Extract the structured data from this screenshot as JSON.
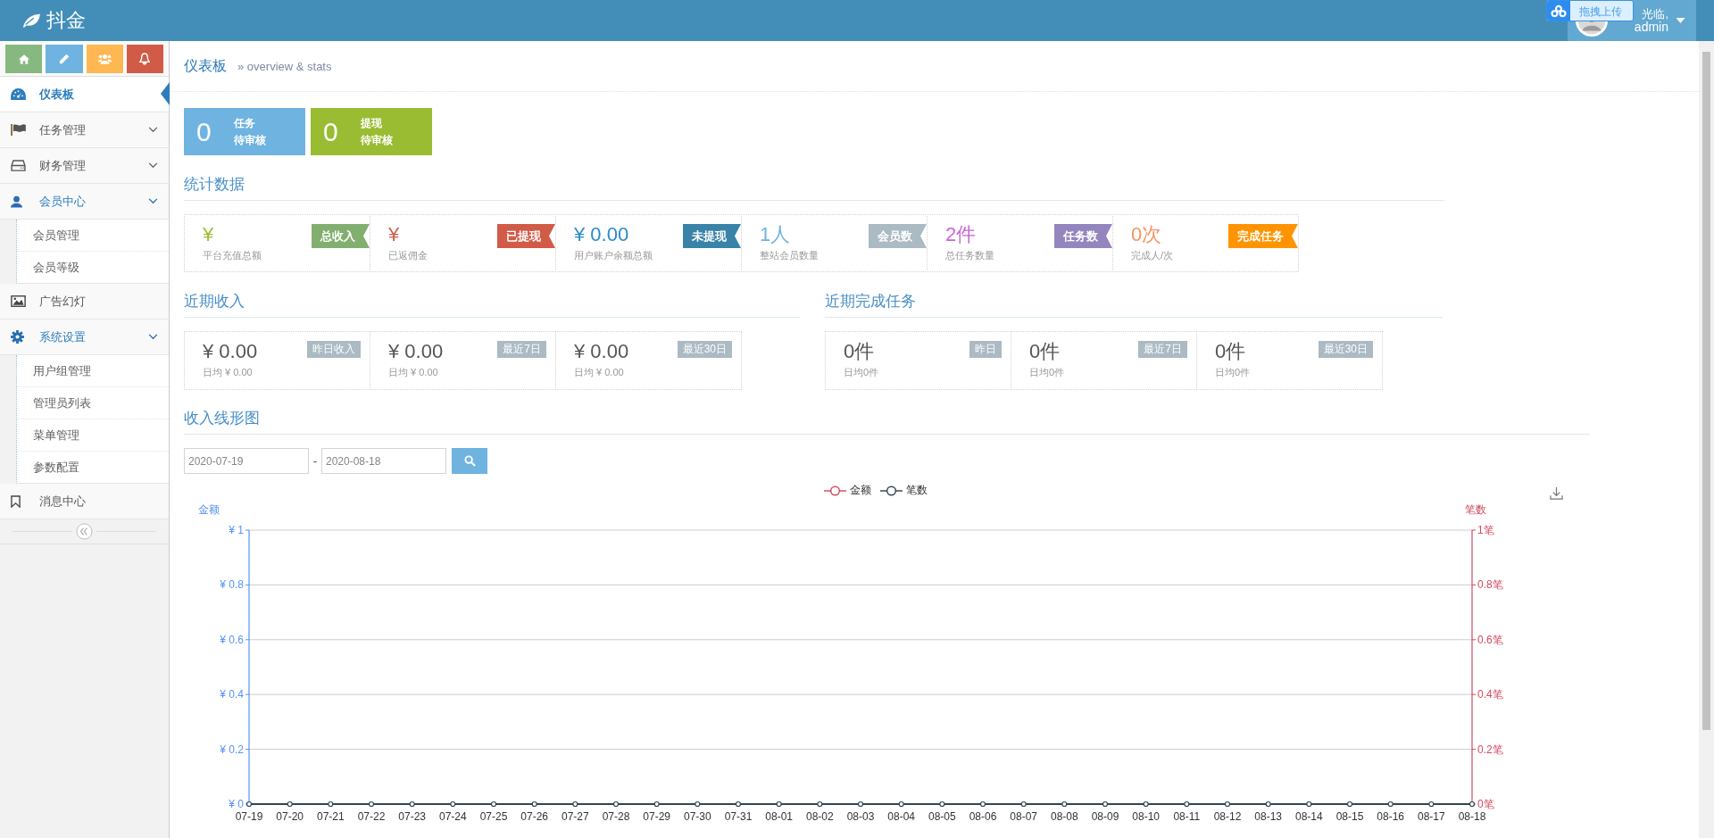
{
  "app": {
    "title": "抖金"
  },
  "upload_widget": {
    "label": "拖拽上传"
  },
  "user": {
    "greeting": "光临,",
    "name": "admin"
  },
  "shortcuts": [
    {
      "color": "#87b87f"
    },
    {
      "color": "#6fb3e0"
    },
    {
      "color": "#ffb752"
    },
    {
      "color": "#d15b47"
    }
  ],
  "sidebar": {
    "items": [
      {
        "label": "仪表板",
        "selected": true
      },
      {
        "label": "任务管理",
        "selected": false,
        "expanded": false
      },
      {
        "label": "财务管理",
        "selected": false,
        "expanded": false
      },
      {
        "label": "会员中心",
        "selected": false,
        "expanded": true,
        "children": [
          {
            "label": "会员管理"
          },
          {
            "label": "会员等级"
          }
        ]
      },
      {
        "label": "广告幻灯",
        "selected": false
      },
      {
        "label": "系统设置",
        "selected": false,
        "expanded": true,
        "children": [
          {
            "label": "用户组管理"
          },
          {
            "label": "管理员列表"
          },
          {
            "label": "菜单管理"
          },
          {
            "label": "参数配置"
          }
        ]
      },
      {
        "label": "消息中心",
        "selected": false
      }
    ]
  },
  "breadcrumb": {
    "title": "仪表板",
    "subtitle": "» overview & stats"
  },
  "pending": [
    {
      "count": "0",
      "title": "任务",
      "subtitle": "待审核",
      "color": "#6fb3e0"
    },
    {
      "count": "0",
      "title": "提现",
      "subtitle": "待审核",
      "color": "#9abc32"
    }
  ],
  "stats": {
    "title": "统计数据",
    "cards": [
      {
        "value": {
          "text": "¥",
          "color": "#9abc32"
        },
        "label": "平台充值总额",
        "tag": {
          "text": "总收入",
          "color": "#82af6f"
        }
      },
      {
        "value": {
          "text": "¥",
          "color": "#d15b47"
        },
        "label": "已返佣金",
        "tag": {
          "text": "已提现",
          "color": "#d15b47"
        }
      },
      {
        "value": {
          "text": "¥ 0.00",
          "color": "#2a8bcb"
        },
        "label": "用户账户余额总额",
        "tag": {
          "text": "未提现",
          "color": "#3983a8"
        }
      },
      {
        "value": {
          "text": "1人",
          "color": "#6fb3e0"
        },
        "label": "整站会员数量",
        "tag": {
          "text": "会员数",
          "color": "#abbac3"
        }
      },
      {
        "value": {
          "text": "2件",
          "color": "#c866d6"
        },
        "label": "总任务数量",
        "tag": {
          "text": "任务数",
          "color": "#9585bf"
        }
      },
      {
        "value": {
          "text": "0次",
          "color": "#f79263"
        },
        "label": "完成人/次",
        "tag": {
          "text": "完成任务",
          "color": "#ff9400"
        }
      }
    ]
  },
  "recent_income": {
    "title": "近期收入",
    "cards": [
      {
        "value": "¥ 0.00",
        "sub": "日均 ¥ 0.00",
        "tag": "昨日收入"
      },
      {
        "value": "¥ 0.00",
        "sub": "日均 ¥ 0.00",
        "tag": "最近7日"
      },
      {
        "value": "¥ 0.00",
        "sub": "日均 ¥ 0.00",
        "tag": "最近30日"
      }
    ]
  },
  "recent_tasks": {
    "title": "近期完成任务",
    "cards": [
      {
        "value": "0件",
        "sub": "日均0件",
        "tag": "昨日"
      },
      {
        "value": "0件",
        "sub": "日均0件",
        "tag": "最近7日"
      },
      {
        "value": "0件",
        "sub": "日均0件",
        "tag": "最近30日"
      }
    ]
  },
  "income_chart": {
    "title": "收入线形图",
    "date_from": "2020-07-19",
    "date_to": "2020-08-18",
    "separator": "-",
    "right_axis": {
      "label": "笔数",
      "ticks": [
        "1笔",
        "0.8笔",
        "0.6笔",
        "0.4笔",
        "0.2笔",
        "0笔"
      ]
    },
    "chart_data": {
      "type": "line",
      "ylabel": "金额",
      "categories": [
        "07-19",
        "07-20",
        "07-21",
        "07-22",
        "07-23",
        "07-24",
        "07-25",
        "07-26",
        "07-27",
        "07-28",
        "07-29",
        "07-30",
        "07-31",
        "08-01",
        "08-02",
        "08-03",
        "08-04",
        "08-05",
        "08-06",
        "08-07",
        "08-08",
        "08-09",
        "08-10",
        "08-11",
        "08-12",
        "08-13",
        "08-14",
        "08-15",
        "08-16",
        "08-17",
        "08-18"
      ],
      "ylim": [
        0,
        1
      ],
      "grid": true,
      "legend": "top",
      "yticks": [
        {
          "value": 0,
          "label": "¥ 0"
        },
        {
          "value": 0.2,
          "label": "¥ 0.2"
        },
        {
          "value": 0.4,
          "label": "¥ 0.4"
        },
        {
          "value": 0.6,
          "label": "¥ 0.6"
        },
        {
          "value": 0.8,
          "label": "¥ 0.8"
        },
        {
          "value": 1,
          "label": "¥ 1"
        }
      ],
      "series": [
        {
          "name": "金额",
          "color": "#d14a61",
          "marker": "circle",
          "values": [
            null,
            null,
            null,
            null,
            null,
            null,
            null,
            null,
            null,
            null,
            null,
            null,
            null,
            null,
            null,
            null,
            null,
            null,
            null,
            null,
            null,
            null,
            null,
            null,
            null,
            null,
            null,
            null,
            null,
            null,
            null
          ]
        },
        {
          "name": "笔数",
          "color": "#2f4554",
          "marker": "circle",
          "values": [
            0,
            0,
            0,
            0,
            0,
            0,
            0,
            0,
            0,
            0,
            0,
            0,
            0,
            0,
            0,
            0,
            0,
            0,
            0,
            0,
            0,
            0,
            0,
            0,
            0,
            0,
            0,
            0,
            0,
            0,
            0
          ]
        }
      ]
    }
  }
}
